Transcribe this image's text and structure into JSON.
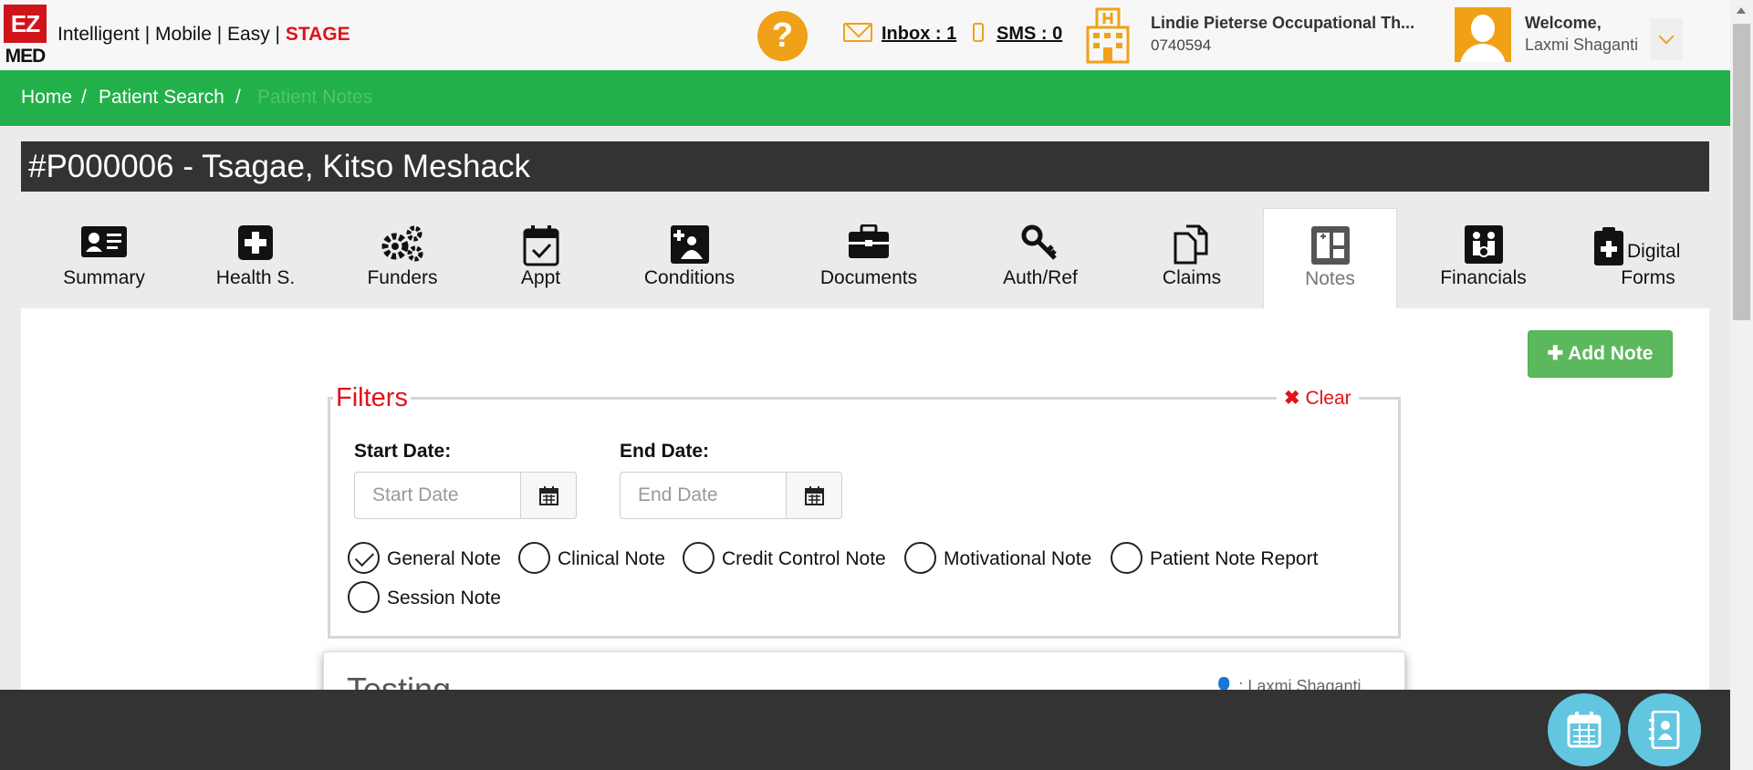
{
  "header": {
    "logo_top": "EZ",
    "logo_bottom": "MED",
    "tagline": "Intelligent | Mobile | Easy | ",
    "tagline_stage": "STAGE",
    "help_label": "?",
    "inbox_label": "Inbox : 1",
    "sms_label": "SMS : 0",
    "practice_name": "Lindie Pieterse Occupational Th...",
    "practice_number": "0740594",
    "welcome": "Welcome,",
    "username": "Laxmi Shaganti"
  },
  "breadcrumb": {
    "items": [
      "Home",
      "Patient Search",
      "Patient Notes"
    ],
    "separator": "/"
  },
  "patient": {
    "title": "#P000006 - Tsagae, Kitso Meshack"
  },
  "tabs": [
    {
      "label": "Summary"
    },
    {
      "label": "Health S."
    },
    {
      "label": "Funders"
    },
    {
      "label": "Appt"
    },
    {
      "label": "Conditions"
    },
    {
      "label": "Documents"
    },
    {
      "label": "Auth/Ref"
    },
    {
      "label": "Claims"
    },
    {
      "label": "Notes",
      "active": true
    },
    {
      "label": "Financials"
    },
    {
      "label": "Digital",
      "label2": "Forms"
    }
  ],
  "actions": {
    "add_note": "Add Note"
  },
  "filters": {
    "title": "Filters",
    "clear": "Clear",
    "start_label": "Start Date:",
    "start_placeholder": "Start Date",
    "end_label": "End Date:",
    "end_placeholder": "End Date",
    "note_types": [
      {
        "label": "General Note",
        "checked": true
      },
      {
        "label": "Clinical Note",
        "checked": false
      },
      {
        "label": "Credit Control Note",
        "checked": false
      },
      {
        "label": "Motivational Note",
        "checked": false
      },
      {
        "label": "Patient Note Report",
        "checked": false
      },
      {
        "label": "Session Note",
        "checked": false
      }
    ]
  },
  "note_card": {
    "title": "Testing",
    "author": "Laxmi Shaganti"
  },
  "colors": {
    "brand_red": "#d0141b",
    "accent_orange": "#f0a117",
    "breadcrumb_green": "#22b04b",
    "add_button_green": "#5cb85c",
    "fab_blue": "#62c6e0",
    "dark_bar": "#333333"
  }
}
